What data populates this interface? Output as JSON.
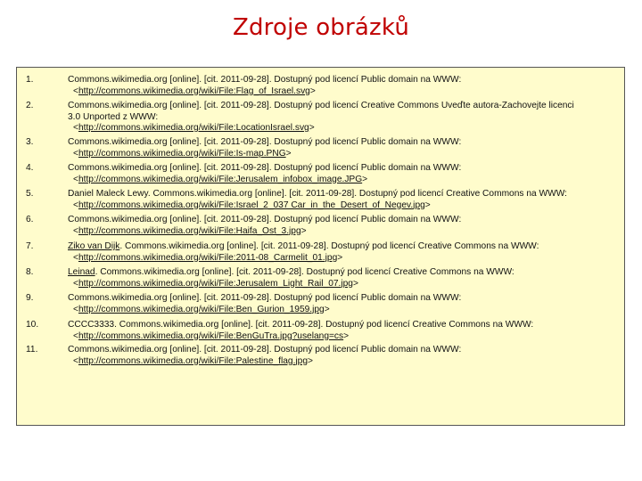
{
  "title": "Zdroje obrázků",
  "references": [
    {
      "num": "1.",
      "author": "",
      "lines": [
        "Commons.wikimedia.org [online]. [cit. 2011-09-28]. Dostupný pod licencí Public domain na WWW:"
      ],
      "link_prefix": "<",
      "link": "http://commons.wikimedia.org/wiki/File:Flag_of_Israel.svg",
      "link_suffix": ">"
    },
    {
      "num": "2.",
      "author": "",
      "lines": [
        "Commons.wikimedia.org [online]. [cit. 2011-09-28]. Dostupný pod licencí Creative Commons Uveďte autora-Zachovejte licenci",
        "3.0 Unported z WWW:"
      ],
      "link_prefix": "<",
      "link": "http://commons.wikimedia.org/wiki/File:LocationIsrael.svg",
      "link_suffix": ">"
    },
    {
      "num": "3.",
      "author": "",
      "lines": [
        "Commons.wikimedia.org [online]. [cit. 2011-09-28]. Dostupný pod licencí Public domain na WWW:"
      ],
      "link_prefix": "<",
      "link": "http://commons.wikimedia.org/wiki/File:Is-map.PNG",
      "link_suffix": ">"
    },
    {
      "num": "4.",
      "author": "",
      "lines": [
        "Commons.wikimedia.org [online]. [cit. 2011-09-28]. Dostupný pod licencí Public domain na WWW:"
      ],
      "link_prefix": "<",
      "link": "http://commons.wikimedia.org/wiki/File:Jerusalem_infobox_image.JPG",
      "link_suffix": ">"
    },
    {
      "num": "5.",
      "author": "",
      "lines": [
        "Daniel Maleck Lewy. Commons.wikimedia.org [online]. [cit. 2011-09-28]. Dostupný pod licencí Creative Commons na WWW:"
      ],
      "link_prefix": "<",
      "link": "http://commons.wikimedia.org/wiki/File:Israel_2_037 Car_in_the_Desert_of_Negev.jpg",
      "link_suffix": ">"
    },
    {
      "num": "6.",
      "author": "",
      "lines": [
        "Commons.wikimedia.org [online]. [cit. 2011-09-28]. Dostupný pod licencí Public domain na WWW:"
      ],
      "link_prefix": "<",
      "link": "http://commons.wikimedia.org/wiki/File:Haifa_Ost_3.jpg",
      "link_suffix": ">"
    },
    {
      "num": "7.",
      "author": "Ziko van Dijk",
      "lines": [
        ". Commons.wikimedia.org [online]. [cit. 2011-09-28]. Dostupný pod licencí Creative Commons na WWW:"
      ],
      "link_prefix": "<",
      "link": "http://commons.wikimedia.org/wiki/File:2011-08_Carmelit_01.jpg",
      "link_suffix": ">"
    },
    {
      "num": "8.",
      "author": "Leinad",
      "lines": [
        ". Commons.wikimedia.org [online]. [cit. 2011-09-28]. Dostupný pod licencí Creative Commons na WWW:"
      ],
      "link_prefix": "<",
      "link": "http://commons.wikimedia.org/wiki/File:Jerusalem_Light_Rail_07.jpg",
      "link_suffix": ">"
    },
    {
      "num": "9.",
      "author": "",
      "lines": [
        "Commons.wikimedia.org [online]. [cit. 2011-09-28]. Dostupný pod licencí Public domain na WWW:"
      ],
      "link_prefix": "<",
      "link": "http://commons.wikimedia.org/wiki/File:Ben_Gurion_1959.jpg",
      "link_suffix": ">"
    },
    {
      "num": "10.",
      "author": "",
      "lines": [
        "CCCC3333. Commons.wikimedia.org [online]. [cit. 2011-09-28]. Dostupný pod licencí Creative Commons na WWW:"
      ],
      "link_prefix": "<",
      "link": "http://commons.wikimedia.org/wiki/File:BenGuTra.jpg?uselang=cs",
      "link_suffix": ">"
    },
    {
      "num": "11.",
      "author": "",
      "lines": [
        "Commons.wikimedia.org [online]. [cit. 2011-09-28]. Dostupný pod licencí Public domain na WWW:"
      ],
      "link_prefix": "<",
      "link": "http://commons.wikimedia.org/wiki/File:Palestine_flag.jpg",
      "link_suffix": ">"
    }
  ]
}
